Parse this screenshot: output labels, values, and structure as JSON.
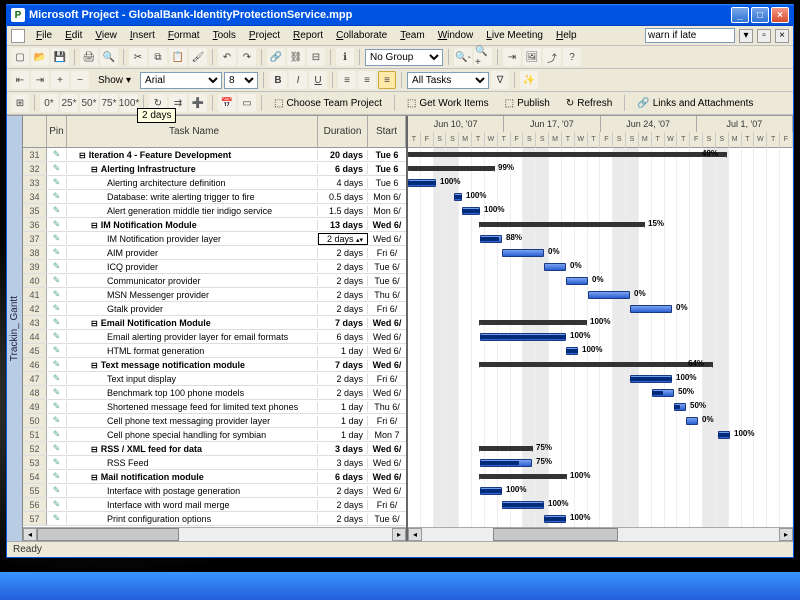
{
  "title": "Microsoft Project - GlobalBank-IdentityProtectionService.mpp",
  "menu": [
    "File",
    "Edit",
    "View",
    "Insert",
    "Format",
    "Tools",
    "Project",
    "Report",
    "Collaborate",
    "Team",
    "Window",
    "Live Meeting",
    "Help"
  ],
  "filter_value": "warn if late",
  "group_select": "No Group",
  "show_label": "Show",
  "font_name": "Arial",
  "font_size": "8",
  "tasks_filter": "All Tasks",
  "tooltip": "2 days",
  "sidetab": "Trackin_ Gantt",
  "team_toolbar": {
    "choose": "Choose Team Project",
    "getwork": "Get Work Items",
    "publish": "Publish",
    "refresh": "Refresh",
    "links": "Links and Attachments"
  },
  "headers": {
    "id": "",
    "info": "Pin",
    "name": "Task Name",
    "dur": "Duration",
    "start": "Start"
  },
  "weeks": [
    "Jun 10, '07",
    "Jun 17, '07",
    "Jun 24, '07",
    "Jul 1, '07"
  ],
  "days": [
    "T",
    "F",
    "S",
    "S",
    "M",
    "T",
    "W",
    "T",
    "F",
    "S",
    "S",
    "M",
    "T",
    "W",
    "T",
    "F",
    "S",
    "S",
    "M",
    "T",
    "W",
    "T",
    "F",
    "S",
    "S",
    "M",
    "T",
    "W",
    "T",
    "F"
  ],
  "status": "Ready",
  "rows": [
    {
      "id": 31,
      "name": "Iteration 4 - Feature Development",
      "dur": "20 days",
      "start": "Tue 6",
      "sum": true,
      "lvl": 0,
      "bl": 0,
      "bw": 318,
      "pct": "49%",
      "pend": true
    },
    {
      "id": 32,
      "name": "Alerting Infrastructure",
      "dur": "6 days",
      "start": "Tue 6",
      "sum": true,
      "lvl": 1,
      "bl": 0,
      "bw": 86,
      "pct": "99%"
    },
    {
      "id": 33,
      "name": "Alerting architecture definition",
      "dur": "4 days",
      "start": "Tue 6",
      "lvl": 2,
      "bl": 0,
      "bw": 28,
      "pct": "100%",
      "prog": 1
    },
    {
      "id": 34,
      "name": "Database: write alerting trigger to fire",
      "dur": "0.5 days",
      "start": "Mon 6/",
      "lvl": 2,
      "bl": 46,
      "bw": 8,
      "pct": "100%",
      "prog": 1
    },
    {
      "id": 35,
      "name": "Alert generation middle tier indigo service",
      "dur": "1.5 days",
      "start": "Mon 6/",
      "lvl": 2,
      "bl": 54,
      "bw": 18,
      "pct": "100%",
      "prog": 1
    },
    {
      "id": 36,
      "name": "IM Notification Module",
      "dur": "13 days",
      "start": "Wed 6/",
      "sum": true,
      "lvl": 1,
      "bl": 72,
      "bw": 164,
      "pct": "15%"
    },
    {
      "id": 37,
      "name": "IM Notification provider layer",
      "dur": "2 days",
      "start": "Wed 6/",
      "lvl": 2,
      "bl": 72,
      "bw": 22,
      "pct": "88%",
      "prog": 0.88,
      "sel": true
    },
    {
      "id": 38,
      "name": "AIM provider",
      "dur": "2 days",
      "start": "Fri 6/",
      "lvl": 2,
      "bl": 94,
      "bw": 42,
      "pct": "0%"
    },
    {
      "id": 39,
      "name": "ICQ provider",
      "dur": "2 days",
      "start": "Tue 6/",
      "lvl": 2,
      "bl": 136,
      "bw": 22,
      "pct": "0%"
    },
    {
      "id": 40,
      "name": "Communicator provider",
      "dur": "2 days",
      "start": "Tue 6/",
      "lvl": 2,
      "bl": 158,
      "bw": 22,
      "pct": "0%"
    },
    {
      "id": 41,
      "name": "MSN Messenger provider",
      "dur": "2 days",
      "start": "Thu 6/",
      "lvl": 2,
      "bl": 180,
      "bw": 42,
      "pct": "0%"
    },
    {
      "id": 42,
      "name": "Gtalk provider",
      "dur": "2 days",
      "start": "Fri 6/",
      "lvl": 2,
      "bl": 222,
      "bw": 42,
      "pct": "0%"
    },
    {
      "id": 43,
      "name": "Email Notification Module",
      "dur": "7 days",
      "start": "Wed 6/",
      "sum": true,
      "lvl": 1,
      "bl": 72,
      "bw": 106,
      "pct": "100%"
    },
    {
      "id": 44,
      "name": "Email alerting provider layer for email formats",
      "dur": "6 days",
      "start": "Wed 6/",
      "lvl": 2,
      "bl": 72,
      "bw": 86,
      "pct": "100%",
      "prog": 1
    },
    {
      "id": 45,
      "name": "HTML format generation",
      "dur": "1 day",
      "start": "Wed 6/",
      "lvl": 2,
      "bl": 158,
      "bw": 12,
      "pct": "100%",
      "prog": 1
    },
    {
      "id": 46,
      "name": "Text message notification module",
      "dur": "7 days",
      "start": "Wed 6/",
      "sum": true,
      "lvl": 1,
      "bl": 72,
      "bw": 232,
      "pct": "64%",
      "pend": true
    },
    {
      "id": 47,
      "name": "Text input display",
      "dur": "2 days",
      "start": "Fri 6/",
      "lvl": 2,
      "bl": 222,
      "bw": 42,
      "pct": "100%",
      "prog": 1
    },
    {
      "id": 48,
      "name": "Benchmark top 100 phone models",
      "dur": "2 days",
      "start": "Wed 6/",
      "lvl": 2,
      "bl": 244,
      "bw": 22,
      "pct": "50%",
      "prog": 0.5
    },
    {
      "id": 49,
      "name": "Shortened message feed for limited text phones",
      "dur": "1 day",
      "start": "Thu 6/",
      "lvl": 2,
      "bl": 266,
      "bw": 12,
      "pct": "50%",
      "prog": 0.5
    },
    {
      "id": 50,
      "name": "Cell phone text messaging provider layer",
      "dur": "1 day",
      "start": "Fri 6/",
      "lvl": 2,
      "bl": 278,
      "bw": 12,
      "pct": "0%"
    },
    {
      "id": 51,
      "name": "Cell phone special handling for symbian",
      "dur": "1 day",
      "start": "Mon 7",
      "lvl": 2,
      "bl": 310,
      "bw": 12,
      "pct": "100%",
      "prog": 1
    },
    {
      "id": 52,
      "name": "RSS / XML feed for data",
      "dur": "3 days",
      "start": "Wed 6/",
      "sum": true,
      "lvl": 1,
      "bl": 72,
      "bw": 52,
      "pct": "75%"
    },
    {
      "id": 53,
      "name": "RSS Feed",
      "dur": "3 days",
      "start": "Wed 6/",
      "lvl": 2,
      "bl": 72,
      "bw": 52,
      "pct": "75%",
      "prog": 0.75
    },
    {
      "id": 54,
      "name": "Mail notification module",
      "dur": "6 days",
      "start": "Wed 6/",
      "sum": true,
      "lvl": 1,
      "bl": 72,
      "bw": 86,
      "pct": "100%"
    },
    {
      "id": 55,
      "name": "Interface with postage generation",
      "dur": "2 days",
      "start": "Wed 6/",
      "lvl": 2,
      "bl": 72,
      "bw": 22,
      "pct": "100%",
      "prog": 1
    },
    {
      "id": 56,
      "name": "Interface with word mail merge",
      "dur": "2 days",
      "start": "Fri 6/",
      "lvl": 2,
      "bl": 94,
      "bw": 42,
      "pct": "100%",
      "prog": 1
    },
    {
      "id": 57,
      "name": "Print configuration options",
      "dur": "2 days",
      "start": "Tue 6/",
      "lvl": 2,
      "bl": 136,
      "bw": 22,
      "pct": "100%",
      "prog": 1
    }
  ]
}
